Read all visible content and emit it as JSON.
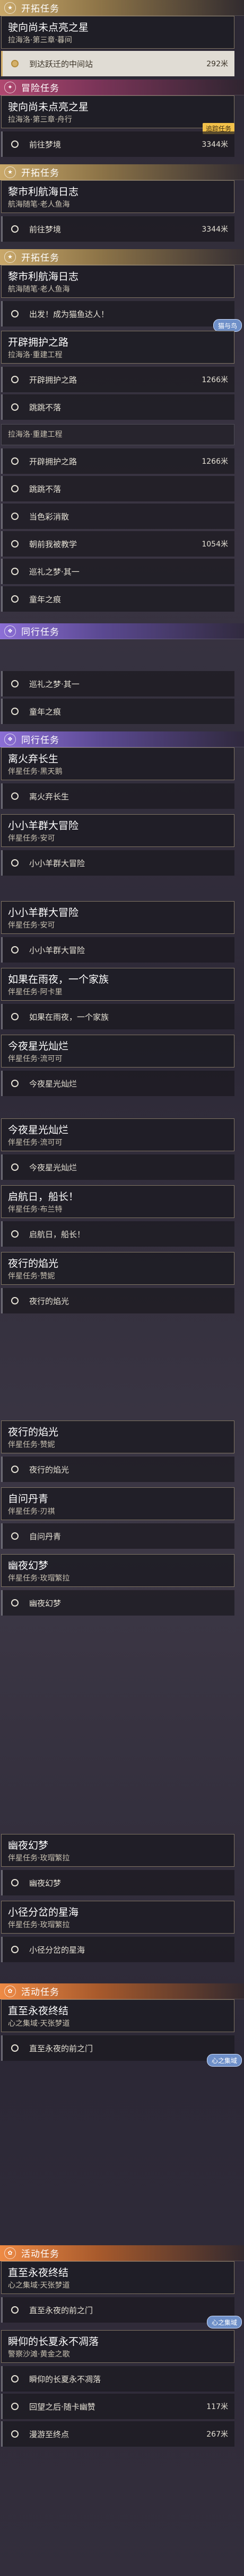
{
  "labels": {
    "main": "开拓任务",
    "side": "冒险任务",
    "companion": "同行任务",
    "event": "活动任务",
    "ongoing_tag": "追踪任务"
  },
  "screens": [
    {
      "items": [
        {
          "kind": "cat",
          "style": "main",
          "icon": "★",
          "label_key": "main"
        },
        {
          "kind": "card",
          "title": "驶向尚未点亮之星",
          "sub": "拉海洛·第三章·暮间"
        },
        {
          "kind": "obj",
          "active": true,
          "text": "到达跃迁的中间站",
          "dist": "292米"
        },
        {
          "kind": "cat",
          "style": "side",
          "icon": "✦",
          "label_key": "side"
        },
        {
          "kind": "card",
          "title": "驶向尚未点亮之星",
          "sub": "拉海洛·第三章·舟行"
        },
        {
          "kind": "obj",
          "text": "前往梦境",
          "dist": "3344米",
          "tag": true
        }
      ]
    }
  ],
  "sections": [
    {
      "key": "main",
      "label": "开拓任务",
      "icon": "★"
    },
    {
      "key": "side",
      "label": "冒险任务",
      "icon": "✦"
    },
    {
      "key": "companion",
      "label": "同行任务",
      "icon": "❖"
    },
    {
      "key": "event",
      "label": "活动任务",
      "icon": "✿"
    }
  ],
  "quests": {
    "q1": {
      "title": "驶向尚未点亮之星",
      "sub": "拉海洛·第三章·暮间"
    },
    "q1o": {
      "text": "到达跃迁的中间站",
      "dist": "292米"
    },
    "q2": {
      "title": "驶向尚未点亮之星",
      "sub": "拉海洛·第三章·舟行"
    },
    "q2o": {
      "text": "前往梦境",
      "dist": "3344米"
    },
    "q3": {
      "title": "黎市利航海日志",
      "sub": "航海随笔·老人鱼海"
    },
    "q3o": {
      "text": "前往梦境",
      "dist": "3344米"
    },
    "q4": {
      "title": "黎市利航海日志",
      "sub": "航海随笔·老人鱼海"
    },
    "q4o": {
      "text": "出发！成为猫鱼达人！",
      "bubble": "猫与鸟"
    },
    "q5": {
      "title": "开辟拥护之路",
      "sub": "拉海洛·重建工程"
    },
    "q5o": {
      "text": "开辟拥护之路",
      "dist": "1266米"
    },
    "q5o2": {
      "text": "跳跳不落"
    },
    "q6sub": {
      "sub": "拉海洛·重建工程"
    },
    "q6o1": {
      "text": "开辟拥护之路",
      "dist": "1266米"
    },
    "q6o2": {
      "text": "跳跳不落"
    },
    "q6o3": {
      "text": "当色彩消散"
    },
    "q6o4": {
      "text": "朝前我被教学",
      "dist": "1054米"
    },
    "q6o5": {
      "text": "巡礼之梦·其一"
    },
    "q6o6": {
      "text": "童年之痕"
    },
    "q7o1": {
      "text": "巡礼之梦·其一"
    },
    "q7o2": {
      "text": "童年之痕"
    },
    "c1": {
      "title": "离火弃长生",
      "sub": "伴星任务·黑天鹅"
    },
    "c1o": {
      "text": "离火弃长生"
    },
    "c2": {
      "title": "小小羊群大冒险",
      "sub": "伴星任务·安可"
    },
    "c2o": {
      "text": "小小羊群大冒险"
    },
    "c3": {
      "title": "小小羊群大冒险",
      "sub": "伴星任务·安可"
    },
    "c3o": {
      "text": "小小羊群大冒险"
    },
    "c4": {
      "title": "如果在雨夜，一个家族",
      "sub": "伴星任务·阿卡里"
    },
    "c4o": {
      "text": "如果在雨夜，一个家族"
    },
    "c5": {
      "title": "今夜星光灿烂",
      "sub": "伴星任务·流可可"
    },
    "c5o": {
      "text": "今夜星光灿烂"
    },
    "c6": {
      "title": "今夜星光灿烂",
      "sub": "伴星任务·流可可"
    },
    "c6o": {
      "text": "今夜星光灿烂"
    },
    "c7": {
      "title": "启航日，船长！",
      "sub": "伴星任务·布兰特"
    },
    "c7o": {
      "text": "启航日，船长！"
    },
    "c8": {
      "title": "夜行的焰光",
      "sub": "伴星任务·赞妮"
    },
    "c8o": {
      "text": "夜行的焰光"
    },
    "c9": {
      "title": "夜行的焰光",
      "sub": "伴星任务·赞妮"
    },
    "c9o": {
      "text": "夜行的焰光"
    },
    "c10": {
      "title": "自问丹青",
      "sub": "伴星任务·刃祺"
    },
    "c10o": {
      "text": "自问丹青"
    },
    "c11": {
      "title": "幽夜幻梦",
      "sub": "伴星任务·玫瑁繁拉"
    },
    "c11o": {
      "text": "幽夜幻梦"
    },
    "c12": {
      "title": "幽夜幻梦",
      "sub": "伴星任务·玫瑁繁拉"
    },
    "c12o": {
      "text": "幽夜幻梦"
    },
    "c13": {
      "title": "小径分岔的星海",
      "sub": "伴星任务·玫瑁繁拉"
    },
    "c13o": {
      "text": "小径分岔的星海"
    },
    "e1": {
      "title": "直至永夜终结",
      "sub": "心之集域·天张梦道"
    },
    "e1o": {
      "text": "直至永夜的前之门",
      "bubble": "心之集域"
    },
    "e2": {
      "title": "直至永夜终结",
      "sub": "心之集域·天张梦道"
    },
    "e2o": {
      "text": "直至永夜的前之门",
      "bubble": "心之集域"
    },
    "e3": {
      "title": "瞬仰的长夏永不凋落",
      "sub": "警察沙滩·黄金之歌"
    },
    "e3o1": {
      "text": "瞬仰的长夏永不凋落"
    },
    "e3o2": {
      "text": "回望之后·随卡幽赞",
      "dist": "117米"
    },
    "e3o3": {
      "text": "漫游至终点",
      "dist": "267米"
    }
  }
}
